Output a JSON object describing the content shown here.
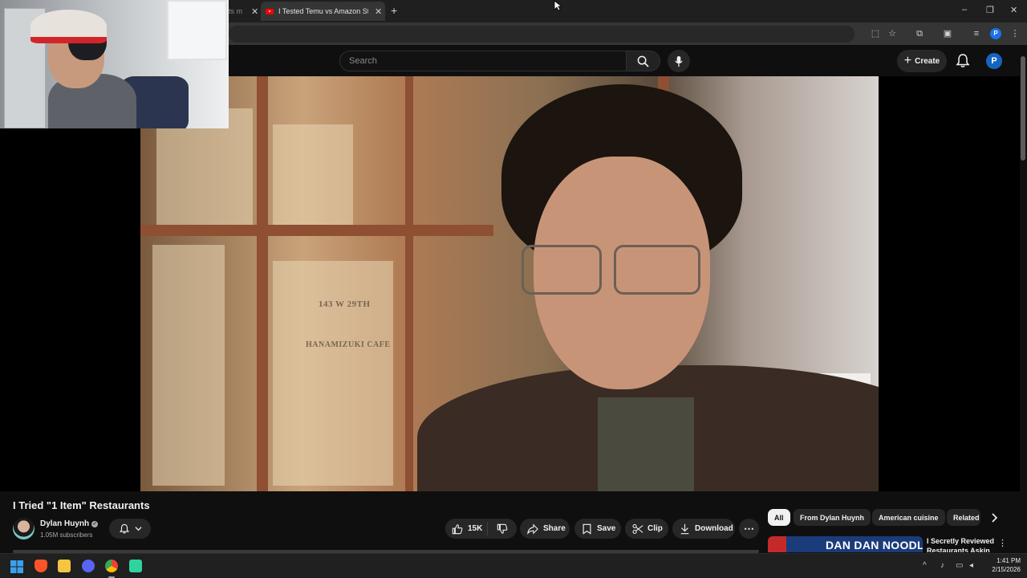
{
  "browser": {
    "tabs": [
      {
        "title": "ts m",
        "active": false
      },
      {
        "title": "I Tested Temu vs Amazon Steal",
        "active": true
      }
    ],
    "new_tab_symbol": "+",
    "tab_close_symbol": "✕",
    "window_controls": [
      "–",
      "❐",
      "✕"
    ],
    "profile_letter": "P"
  },
  "youtube": {
    "search": {
      "placeholder": "Search",
      "value": ""
    },
    "create_label": "Create",
    "avatar_letter": "P"
  },
  "video_overlay": {
    "sign_address": "143 W 29TH",
    "sign_name": "HANAMIZUKI CAFE"
  },
  "video": {
    "title": "I Tried \"1 Item\" Restaurants",
    "channel": {
      "name": "Dylan Huynh",
      "subscribers": "1.05M subscribers",
      "verified": true
    },
    "actions": {
      "likes": "15K",
      "share": "Share",
      "save": "Save",
      "clip": "Clip",
      "download": "Download",
      "more": "⋯"
    }
  },
  "recommendations": {
    "chips": [
      "All",
      "From Dylan Huynh",
      "American cuisine",
      "Related"
    ],
    "selected_chip": "All",
    "items": [
      {
        "thumbnail_text": "DAN DAN NOODLES",
        "title": "I Secretly Reviewed Restaurants Askin"
      }
    ]
  },
  "taskbar": {
    "time": "1:41 PM",
    "date": "2/15/2026"
  },
  "colors": {
    "background": "#0f0f0f",
    "surface": "#272727",
    "accent_red": "#ff0000",
    "avatar_blue": "#1565c0"
  }
}
